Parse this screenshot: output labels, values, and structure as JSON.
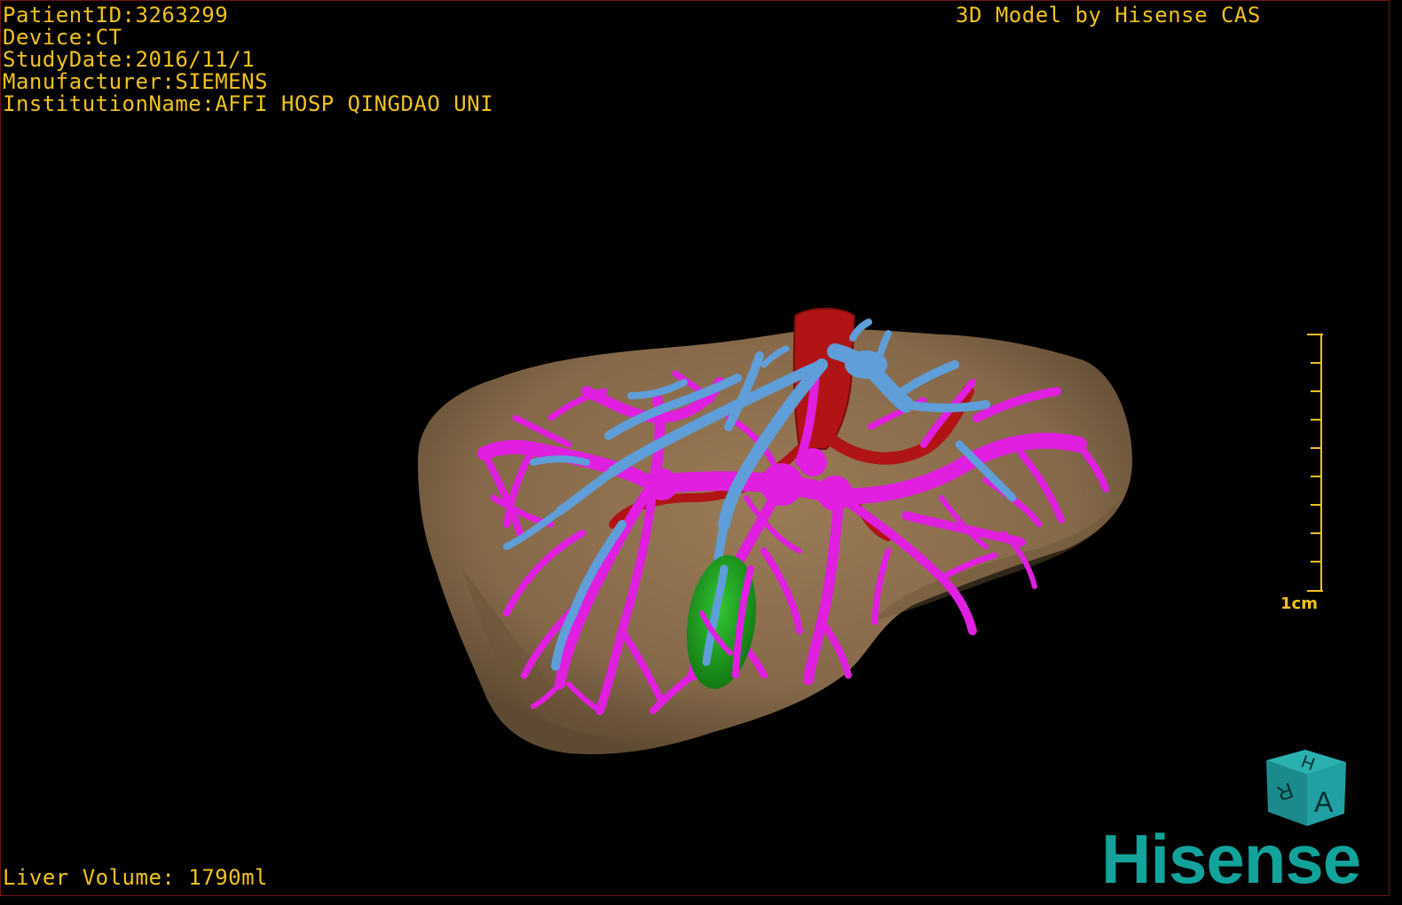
{
  "header": {
    "info_lines": [
      "PatientID:3263299",
      "Device:CT",
      "StudyDate:2016/11/1",
      "Manufacturer:SIEMENS",
      "InstitutionName:AFFI HOSP QINGDAO UNI"
    ],
    "caption": "3D Model by Hisense CAS"
  },
  "footer": {
    "volume": "Liver Volume: 1790ml"
  },
  "scale": {
    "label": "1cm"
  },
  "orientation_cube": {
    "front": "A",
    "top": "H",
    "side": "R"
  },
  "brand": {
    "name": "Hisense"
  },
  "colors": {
    "text": "#f2c21b",
    "liver": "#8f7150",
    "portal_vein": "#e01fe0",
    "hepatic_vein": "#5f9ed8",
    "artery_ivc": "#b01414",
    "gallbladder": "#1fa81f",
    "brand": "#12a39a",
    "border": "#6b1414"
  }
}
